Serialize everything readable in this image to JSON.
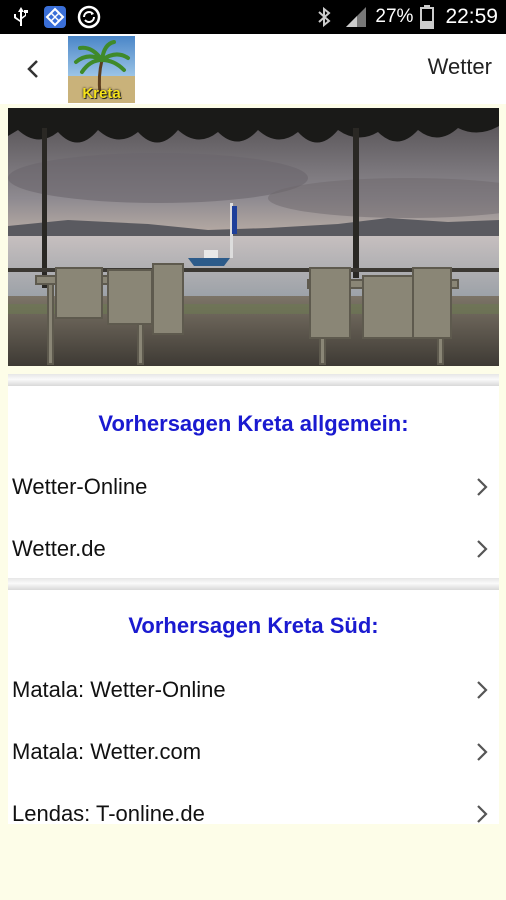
{
  "status_bar": {
    "battery": "27%",
    "time": "22:59",
    "icons": [
      "usb-icon",
      "app-notification-icon",
      "sync-icon",
      "bluetooth-icon",
      "signal-icon",
      "battery-icon"
    ]
  },
  "app_bar": {
    "logo_text": "Kreta",
    "title": "Wetter"
  },
  "sections": [
    {
      "heading": "Vorhersagen Kreta allgemein:",
      "items": [
        "Wetter-Online",
        "Wetter.de"
      ]
    },
    {
      "heading": "Vorhersagen Kreta Süd:",
      "items": [
        "Matala: Wetter-Online",
        "Matala: Wetter.com",
        "Lendas: T-online.de"
      ]
    }
  ],
  "colors": {
    "heading": "#1a1ad0",
    "page_background": "#fdfde8",
    "status_bar": "#000000"
  }
}
